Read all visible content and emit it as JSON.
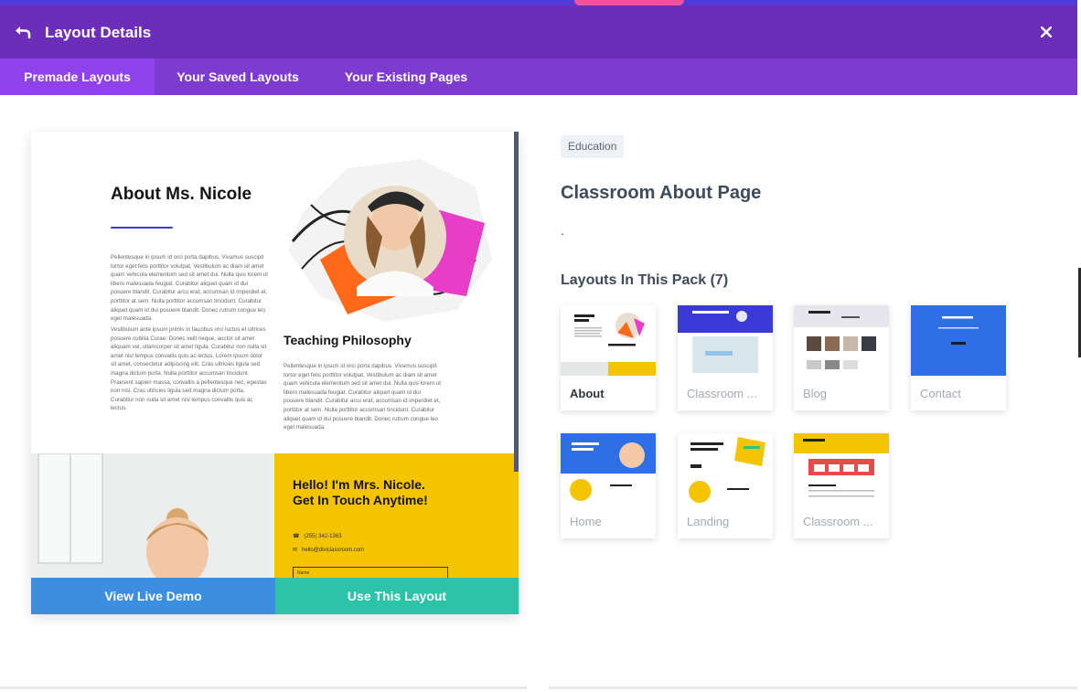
{
  "window": {
    "title": "Layout Details"
  },
  "tabs": [
    {
      "label": "Premade Layouts",
      "active": true
    },
    {
      "label": "Your Saved Layouts",
      "active": false
    },
    {
      "label": "Your Existing Pages",
      "active": false
    }
  ],
  "preview": {
    "heading": "About Ms. Nicole",
    "paragraph_1": "Pellentesque in ipsum id orci porta dapibus. Vivamus suscipit tortor eget felis porttitor volutpat. Vestibulum ac diam sit amet quam vehicula elementum sed sit amet dui. Nulla quis lorem ut libero malesuada feugiat. Curabitur aliquet quam id dui posuere blandit. Curabitur arcu erat, accumsan id imperdiet et, porttitor at sem. Nulla porttitor accumsan tincidunt. Curabitur aliquet quam id dui posuere blandit. Donec rutrum congue leo eget malesuada.",
    "paragraph_2": "Vestibulum ante ipsum primis in faucibus orci luctus et ultrices posuere cubilia Curae; Donec velit neque, auctor sit amet aliquam vel, ullamcorper sit amet ligula. Curabitur non nulla sit amet nisl tempus convallis quis ac lectus. Lorem ipsum dolor sit amet, consectetur adipiscing elit. Cras ultricies ligula sed magna dictum porta. Nulla porttitor accumsan tincidunt. Praesent sapien massa, convallis a pellentesque nec, egestas non nisi. Cras ultricies ligula sed magna dictum porta. Curabitur non nulla sit amet nisl tempus convallis quis ac lectus.",
    "teaching_heading": "Teaching Philosophy",
    "teaching_paragraph": "Pellentesque in ipsum id orci porta dapibus. Vivamus suscipit tortor eget felis porttitor volutpat. Vestibulum ac diam sit amet quam vehicula elementum sed sit amet dui. Nulla quis lorem ut libero malesuada feugiat. Curabitur aliquet quam id dui posuere blandit. Curabitur arcu erat, accumsan id imperdiet et, porttitor at sem. Nulla porttitor accumsan tincidunt. Curabitur aliquet quam id dui posuere blandit. Donec rutrum congue leo eget malesuada.",
    "contact_heading": "Hello! I'm Mrs. Nicole. Get In Touch Anytime!",
    "phone": "(255) 342-1363",
    "email": "hello@diviclassroom.com",
    "name_field": "Name"
  },
  "actions": {
    "live_demo_label": "View Live Demo",
    "use_layout_label": "Use This Layout"
  },
  "details": {
    "category": "Education",
    "layout_name": "Classroom About Page",
    "description": ".",
    "pack_title": "Layouts In This Pack (7)"
  },
  "pack": [
    {
      "label": "About",
      "active": true
    },
    {
      "label": "Classroom ...",
      "active": false
    },
    {
      "label": "Blog",
      "active": false
    },
    {
      "label": "Contact",
      "active": false
    },
    {
      "label": "Home",
      "active": false
    },
    {
      "label": "Landing",
      "active": false
    },
    {
      "label": "Classroom ...",
      "active": false
    }
  ],
  "colors": {
    "header": "#6c2eb9",
    "tabs": "#7e3bd0",
    "tab_active": "#8f42ec",
    "live_demo": "#3c8ee0",
    "use_layout": "#2cc4a8"
  }
}
